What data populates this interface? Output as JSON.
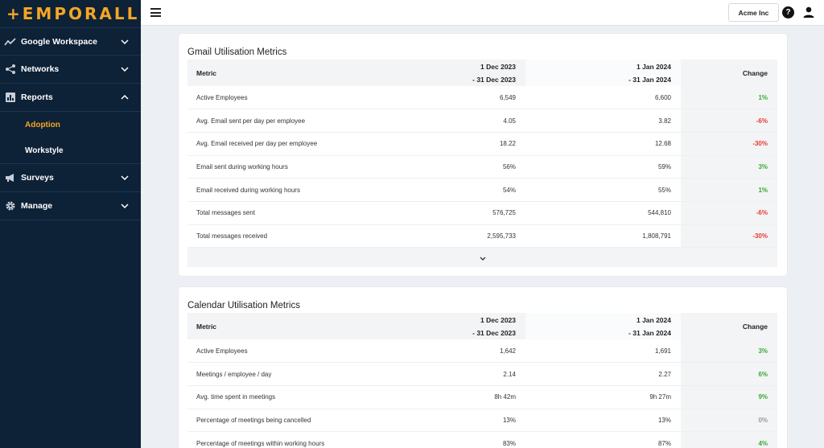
{
  "app": {
    "logo_text": "+EMPORALL"
  },
  "sidebar": {
    "items": [
      {
        "label": "Google Workspace",
        "icon": "trend-icon",
        "expanded": false
      },
      {
        "label": "Networks",
        "icon": "share-icon",
        "expanded": false
      },
      {
        "label": "Reports",
        "icon": "bar-chart-icon",
        "expanded": true,
        "children": [
          {
            "label": "Adoption",
            "active": true
          },
          {
            "label": "Workstyle",
            "active": false
          }
        ]
      },
      {
        "label": "Surveys",
        "icon": "megaphone-icon",
        "expanded": false
      },
      {
        "label": "Manage",
        "icon": "gear-icon",
        "expanded": false
      }
    ]
  },
  "topbar": {
    "org_label": "Acme Inc",
    "help_icon": "?"
  },
  "colors": {
    "sidebar_bg": "#0d2137",
    "accent": "#f5a623",
    "positive": "#3aa835",
    "negative": "#e53935"
  },
  "gmail": {
    "title": "Gmail Utilisation Metrics",
    "headers": {
      "metric": "Metric",
      "period1_a": "1 Dec 2023",
      "period1_b": "- 31 Dec 2023",
      "period2_a": "1 Jan 2024",
      "period2_b": "- 31 Jan 2024",
      "change": "Change"
    },
    "rows": [
      {
        "metric": "Active Employees",
        "p1": "6,549",
        "p2": "6,600",
        "change": "1%",
        "trend": "pos"
      },
      {
        "metric": "Avg. Email sent per day per employee",
        "p1": "4.05",
        "p2": "3.82",
        "change": "-6%",
        "trend": "neg"
      },
      {
        "metric": "Avg. Email received per day per employee",
        "p1": "18.22",
        "p2": "12.68",
        "change": "-30%",
        "trend": "neg"
      },
      {
        "metric": "Email sent during working hours",
        "p1": "56%",
        "p2": "59%",
        "change": "3%",
        "trend": "pos"
      },
      {
        "metric": "Email received during working hours",
        "p1": "54%",
        "p2": "55%",
        "change": "1%",
        "trend": "pos"
      },
      {
        "metric": "Total messages sent",
        "p1": "576,725",
        "p2": "544,810",
        "change": "-6%",
        "trend": "neg"
      },
      {
        "metric": "Total messages received",
        "p1": "2,595,733",
        "p2": "1,808,791",
        "change": "-30%",
        "trend": "neg"
      }
    ]
  },
  "calendar": {
    "title": "Calendar Utilisation Metrics",
    "headers": {
      "metric": "Metric",
      "period1_a": "1 Dec 2023",
      "period1_b": "- 31 Dec 2023",
      "period2_a": "1 Jan 2024",
      "period2_b": "- 31 Jan 2024",
      "change": "Change"
    },
    "rows": [
      {
        "metric": "Active Employees",
        "p1": "1,642",
        "p2": "1,691",
        "change": "3%",
        "trend": "pos"
      },
      {
        "metric": "Meetings / employee / day",
        "p1": "2.14",
        "p2": "2.27",
        "change": "6%",
        "trend": "pos"
      },
      {
        "metric": "Avg. time spent in meetings",
        "p1": "8h 42m",
        "p2": "9h 27m",
        "change": "9%",
        "trend": "pos"
      },
      {
        "metric": "Percentage of meetings being cancelled",
        "p1": "13%",
        "p2": "13%",
        "change": "0%",
        "trend": "neu"
      },
      {
        "metric": "Percentage of meetings within working hours",
        "p1": "83%",
        "p2": "87%",
        "change": "4%",
        "trend": "pos"
      }
    ]
  }
}
